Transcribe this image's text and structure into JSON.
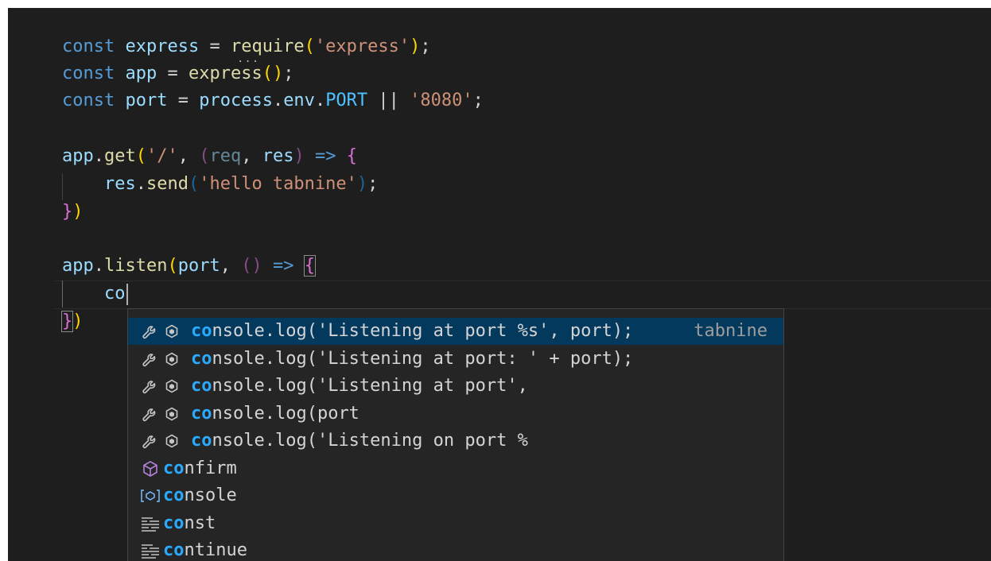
{
  "code_lines": [
    {
      "parts": [
        "const",
        " ",
        "express",
        " = ",
        "require",
        "(",
        "'express'",
        ")",
        ";"
      ]
    },
    {
      "parts": [
        "const",
        " ",
        "app",
        " = ",
        "express",
        "(",
        ")",
        ";"
      ]
    },
    {
      "parts": [
        "const",
        " ",
        "port",
        " = ",
        "process",
        ".",
        "env",
        ".",
        "PORT",
        " || ",
        "'8080'",
        ";"
      ]
    },
    {
      "parts": [
        "app",
        ".",
        "get",
        "(",
        "'/'",
        ", ",
        "(",
        "req",
        ", ",
        "res",
        ")",
        " => ",
        "{"
      ]
    },
    {
      "parts": [
        "    ",
        "res",
        ".",
        "send",
        "(",
        "'hello tabnine'",
        ")",
        ";"
      ]
    },
    {
      "parts": [
        "}",
        ")"
      ]
    },
    {
      "parts": [
        "app",
        ".",
        "listen",
        "(",
        "port",
        ", ",
        "(",
        ")",
        " => ",
        "{"
      ]
    },
    {
      "parts": [
        "    ",
        "co"
      ]
    },
    {
      "parts": [
        "}",
        ")"
      ]
    }
  ],
  "suggestions": [
    {
      "match": "co",
      "rest": "nsole.log('Listening at port %s', port);",
      "detail": "tabnine",
      "selected": true,
      "kind": "tabnine"
    },
    {
      "match": "co",
      "rest": "nsole.log('Listening at port: ' + port);",
      "detail": "",
      "selected": false,
      "kind": "tabnine"
    },
    {
      "match": "co",
      "rest": "nsole.log('Listening at port',",
      "detail": "",
      "selected": false,
      "kind": "tabnine"
    },
    {
      "match": "co",
      "rest": "nsole.log(port",
      "detail": "",
      "selected": false,
      "kind": "tabnine"
    },
    {
      "match": "co",
      "rest": "nsole.log('Listening on port %",
      "detail": "",
      "selected": false,
      "kind": "tabnine"
    },
    {
      "match": "co",
      "rest": "nfirm",
      "detail": "",
      "selected": false,
      "kind": "method"
    },
    {
      "match": "co",
      "rest": "nsole",
      "detail": "",
      "selected": false,
      "kind": "variable"
    },
    {
      "match": "co",
      "rest": "nst",
      "detail": "",
      "selected": false,
      "kind": "keyword"
    },
    {
      "match": "co",
      "rest": "ntinue",
      "detail": "",
      "selected": false,
      "kind": "keyword"
    }
  ],
  "colors": {
    "editor_bg": "#1e1e1e",
    "keyword": "#569cd6",
    "variable": "#9cdcfe",
    "function": "#dcdcaa",
    "string": "#ce9178",
    "constant": "#4fc1ff",
    "suggest_bg": "#252526",
    "suggest_selected": "#04395e",
    "match_highlight": "#2aaaff"
  },
  "icons": {
    "tabnine": [
      "wrench-icon",
      "tabnine-logo-icon"
    ],
    "method": "cube-method-icon",
    "variable": "variable-icon",
    "keyword": "keyword-icon"
  }
}
